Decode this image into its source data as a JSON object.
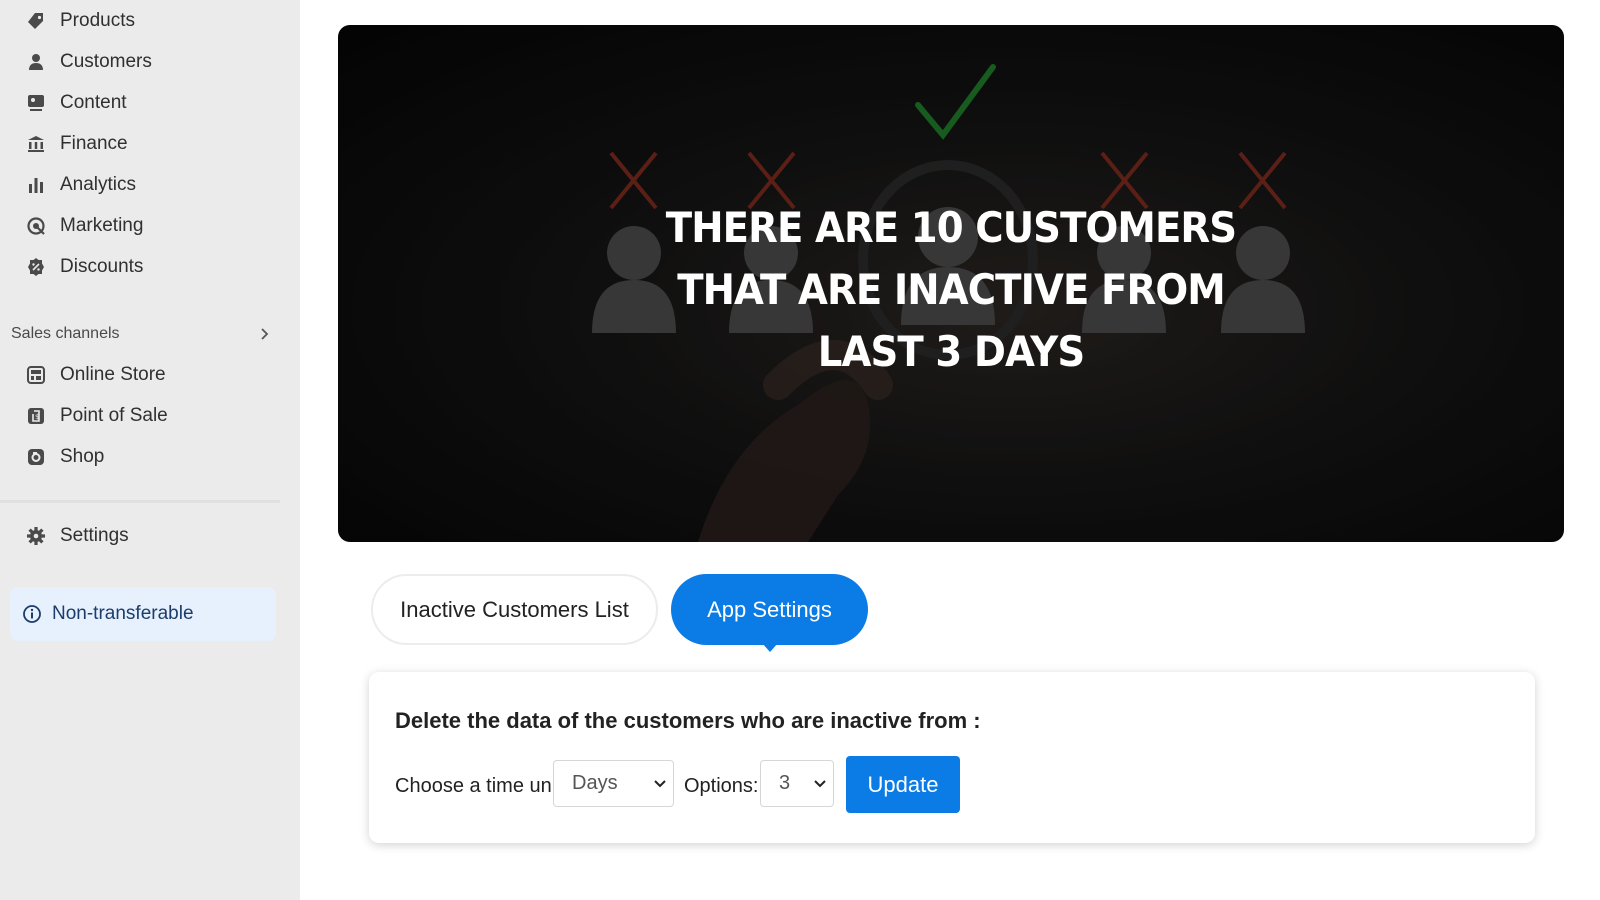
{
  "sidebar": {
    "items": [
      {
        "label": "Products",
        "icon": "tag-icon"
      },
      {
        "label": "Customers",
        "icon": "person-icon"
      },
      {
        "label": "Content",
        "icon": "content-icon"
      },
      {
        "label": "Finance",
        "icon": "bank-icon"
      },
      {
        "label": "Analytics",
        "icon": "bar-chart-icon"
      },
      {
        "label": "Marketing",
        "icon": "target-icon"
      },
      {
        "label": "Discounts",
        "icon": "discount-icon"
      }
    ],
    "sales_channels": {
      "label": "Sales channels",
      "items": [
        {
          "label": "Online Store",
          "icon": "store-icon"
        },
        {
          "label": "Point of Sale",
          "icon": "pos-icon"
        },
        {
          "label": "Shop",
          "icon": "shop-icon"
        }
      ]
    },
    "settings_label": "Settings",
    "badge_label": "Non-transferable"
  },
  "banner": {
    "line1": "THERE ARE 10 CUSTOMERS",
    "line2": "THAT ARE INACTIVE FROM",
    "line3": "LAST 3 DAYS"
  },
  "tabs": {
    "list_label": "Inactive Customers List",
    "settings_label": "App Settings",
    "active": "App Settings"
  },
  "settings_card": {
    "title": "Delete the data of the customers who are inactive from :",
    "time_unit_label": "Choose a time unit:",
    "time_unit_value": "Days",
    "options_label": "Options:",
    "options_value": "3",
    "update_label": "Update"
  },
  "colors": {
    "accent": "#0b7be6",
    "sidebar_bg": "#ebebeb",
    "badge_bg": "#e6f1fd",
    "check_green": "#1f7a2a",
    "cross_red": "#7a2a1e"
  }
}
